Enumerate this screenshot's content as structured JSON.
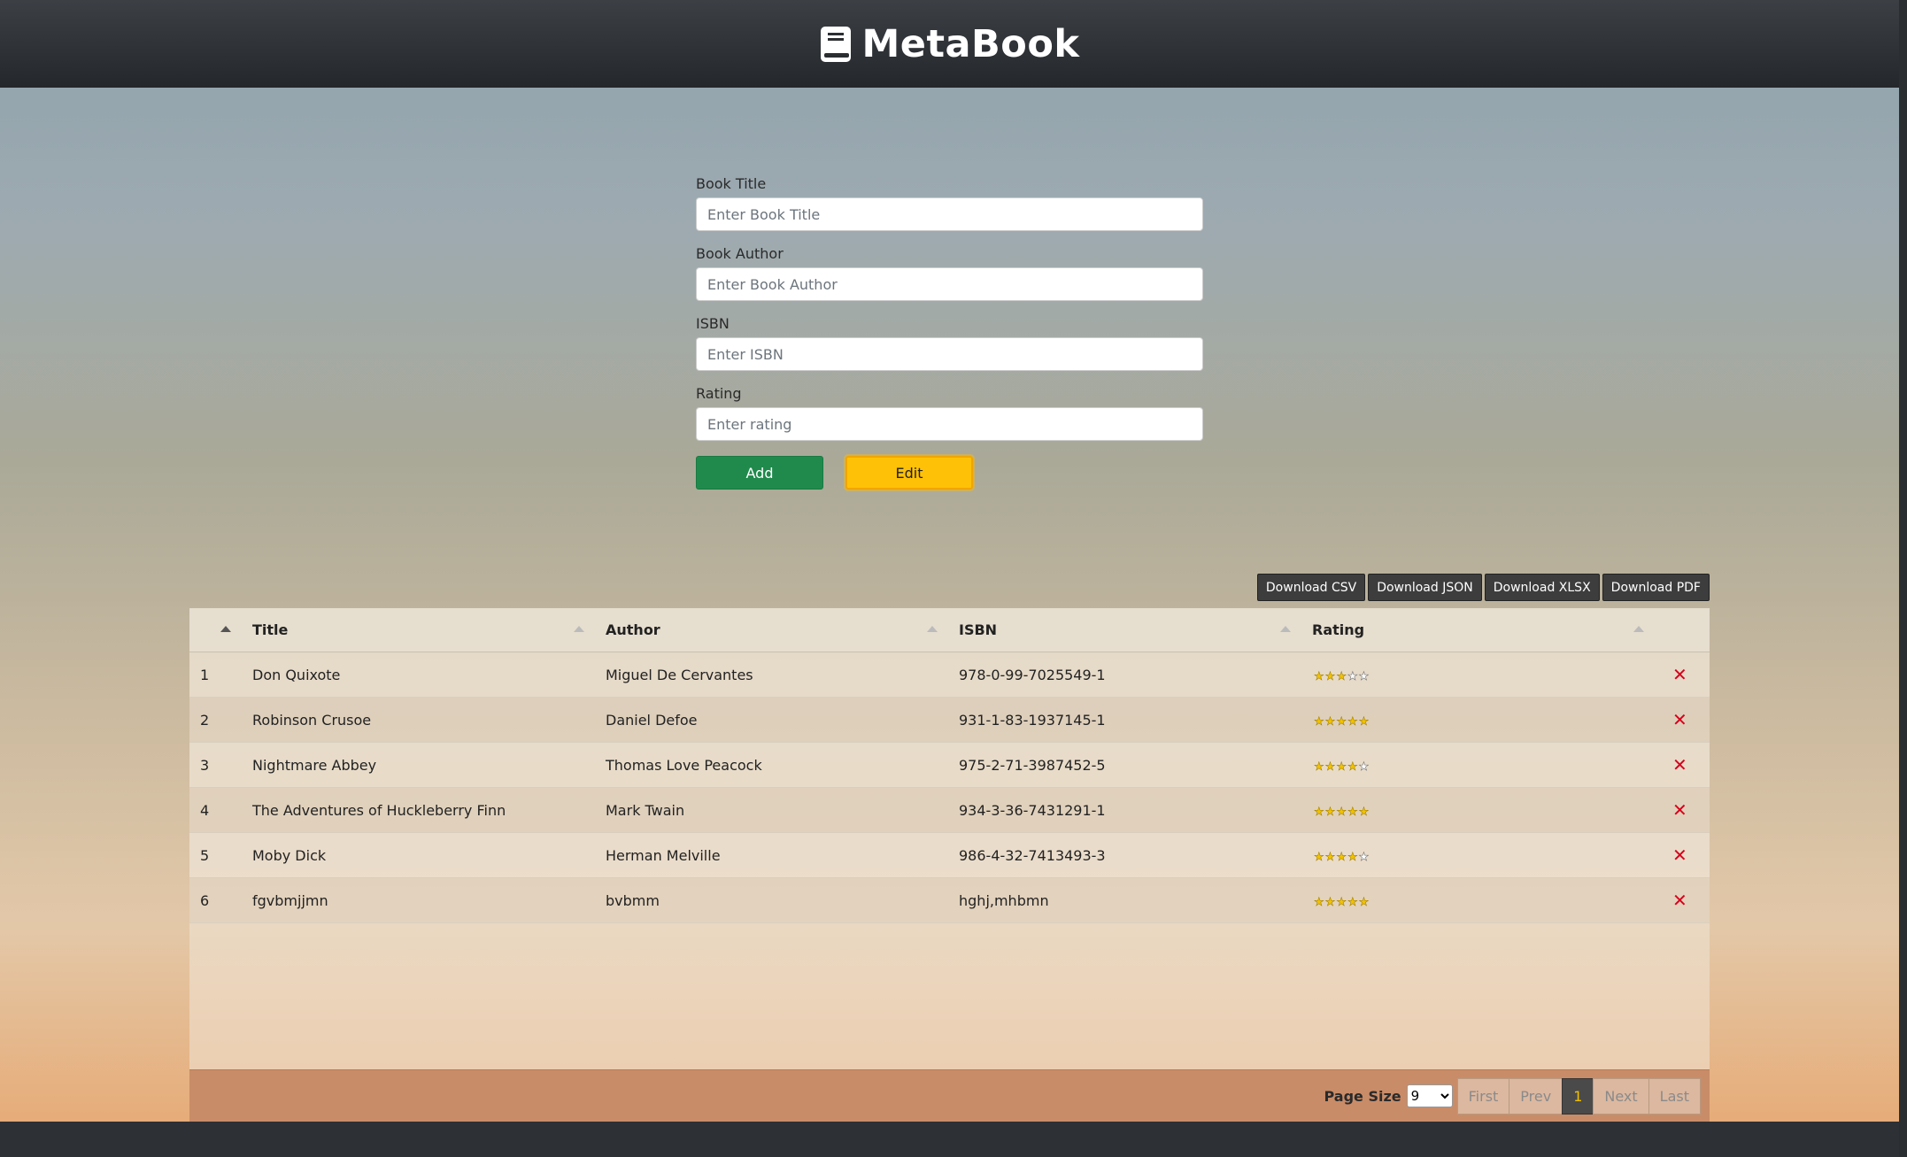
{
  "app": {
    "title": "MetaBook"
  },
  "form": {
    "title_label": "Book Title",
    "title_placeholder": "Enter Book Title",
    "author_label": "Book Author",
    "author_placeholder": "Enter Book Author",
    "isbn_label": "ISBN",
    "isbn_placeholder": "Enter ISBN",
    "rating_label": "Rating",
    "rating_placeholder": "Enter rating",
    "add_label": "Add",
    "edit_label": "Edit"
  },
  "downloads": {
    "csv": "Download CSV",
    "json": "Download JSON",
    "xlsx": "Download XLSX",
    "pdf": "Download PDF"
  },
  "table": {
    "columns": [
      "Title",
      "Author",
      "ISBN",
      "Rating"
    ],
    "rows": [
      {
        "num": "1",
        "title": "Don Quixote",
        "author": "Miguel De Cervantes",
        "isbn": "978-0-99-7025549-1",
        "rating": 3
      },
      {
        "num": "2",
        "title": "Robinson Crusoe",
        "author": "Daniel Defoe",
        "isbn": "931-1-83-1937145-1",
        "rating": 5
      },
      {
        "num": "3",
        "title": "Nightmare Abbey",
        "author": "Thomas Love Peacock",
        "isbn": "975-2-71-3987452-5",
        "rating": 4
      },
      {
        "num": "4",
        "title": "The Adventures of Huckleberry Finn",
        "author": "Mark Twain",
        "isbn": "934-3-36-7431291-1",
        "rating": 5
      },
      {
        "num": "5",
        "title": "Moby Dick",
        "author": "Herman Melville",
        "isbn": "986-4-32-7413493-3",
        "rating": 4
      },
      {
        "num": "6",
        "title": "fgvbmjjmn",
        "author": "bvbmm",
        "isbn": "hghj,mhbmn",
        "rating": 5
      }
    ],
    "max_rating": 5,
    "delete_glyph": "✕"
  },
  "pagination": {
    "page_size_label": "Page Size",
    "page_size_value": "9",
    "first": "First",
    "prev": "Prev",
    "current": "1",
    "next": "Next",
    "last": "Last"
  },
  "colors": {
    "add": "#1f8a4c",
    "edit": "#ffc107",
    "delete": "#d6001c",
    "star": "#f2c200"
  }
}
